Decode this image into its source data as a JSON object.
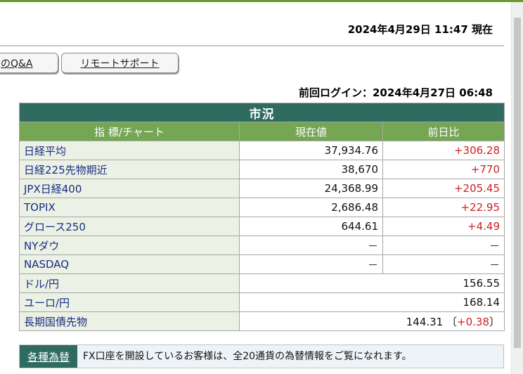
{
  "header": {
    "datetime": "2024年4月29日 11:47 現在"
  },
  "tabs": [
    {
      "label": "のQ&A"
    },
    {
      "label": "リモートサポート"
    }
  ],
  "last_login": "前回ログイン：2024年4月27日 06:48",
  "market": {
    "title": "市況",
    "columns": [
      "指 標/チャート",
      "現在値",
      "前日比"
    ],
    "rows": [
      {
        "name": "日経平均",
        "value": "37,934.76",
        "change": "+306.28"
      },
      {
        "name": "日経225先物期近",
        "value": "38,670",
        "change": "+770"
      },
      {
        "name": "JPX日経400",
        "value": "24,368.99",
        "change": "+205.45"
      },
      {
        "name": "TOPIX",
        "value": "2,686.48",
        "change": "+22.95"
      },
      {
        "name": "グロース250",
        "value": "644.61",
        "change": "+4.49"
      },
      {
        "name": "NYダウ",
        "value": "－",
        "change": "－"
      },
      {
        "name": "NASDAQ",
        "value": "－",
        "change": "－"
      }
    ],
    "fx_rows": [
      {
        "name": "ドル/円",
        "value": "156.55"
      },
      {
        "name": "ユーロ/円",
        "value": "168.14"
      }
    ],
    "bond": {
      "name": "長期国債先物",
      "value": "144.31",
      "paren_open": "〔",
      "change": "+0.38",
      "paren_close": "〕"
    }
  },
  "fx_banner": {
    "button_label": "各種為替",
    "text": "FX口座を開設しているお客様は、全20通貨の為替情報をご覧になれます。"
  },
  "colors": {
    "title_bg": "#2f6b61",
    "header_bg": "#74a653",
    "name_bg": "#ebf1e4",
    "name_text": "#1a2c86",
    "positive": "#cc2020"
  }
}
